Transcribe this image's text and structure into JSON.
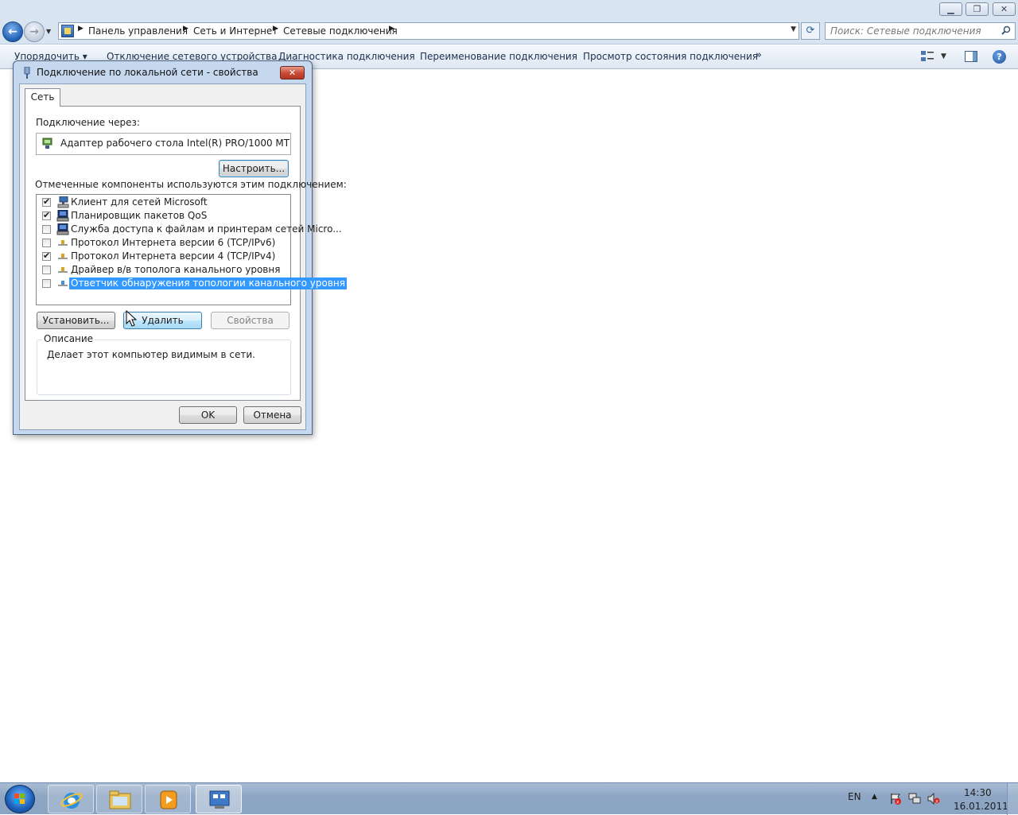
{
  "explorer": {
    "breadcrumbs": [
      "Панель управления",
      "Сеть и Интернет",
      "Сетевые подключения"
    ],
    "search_placeholder": "Поиск: Сетевые подключения",
    "commands": [
      "Упорядочить",
      "Отключение сетевого устройства",
      "Диагностика подключения",
      "Переименование подключения",
      "Просмотр состояния подключения"
    ],
    "more_glyph": "»"
  },
  "dialog": {
    "title": "Подключение по локальной сети - свойства",
    "tab": "Сеть",
    "connect_using_label": "Подключение через:",
    "adapter": "Адаптер рабочего стола Intel(R) PRO/1000 MT",
    "configure_button": "Настроить...",
    "components_label": "Отмеченные компоненты используются этим подключением:",
    "components": [
      {
        "label": "Клиент для сетей Microsoft",
        "checked": true,
        "icon": "network-client-icon"
      },
      {
        "label": "Планировщик пакетов QoS",
        "checked": true,
        "icon": "network-service-icon"
      },
      {
        "label": "Служба доступа к файлам и принтерам сетей Micro...",
        "checked": false,
        "icon": "network-service-icon"
      },
      {
        "label": "Протокол Интернета версии 6 (TCP/IPv6)",
        "checked": false,
        "icon": "protocol-icon"
      },
      {
        "label": "Протокол Интернета версии 4 (TCP/IPv4)",
        "checked": true,
        "icon": "protocol-icon"
      },
      {
        "label": "Драйвер в/в тополога канального уровня",
        "checked": false,
        "icon": "protocol-icon"
      },
      {
        "label": "Ответчик обнаружения топологии канального уровня",
        "checked": false,
        "icon": "protocol-icon",
        "selected": true
      }
    ],
    "install_button": "Установить...",
    "uninstall_button": "Удалить",
    "properties_button": "Свойства",
    "description_legend": "Описание",
    "description_text": "Делает этот компьютер видимым в сети.",
    "ok_button": "OK",
    "cancel_button": "Отмена"
  },
  "taskbar": {
    "language": "EN",
    "time": "14:30",
    "date": "16.01.2011"
  },
  "colors": {
    "selection": "#3399ff",
    "taskbar": "#8fa7c5",
    "dialog_frame": "#c6d8ee"
  }
}
